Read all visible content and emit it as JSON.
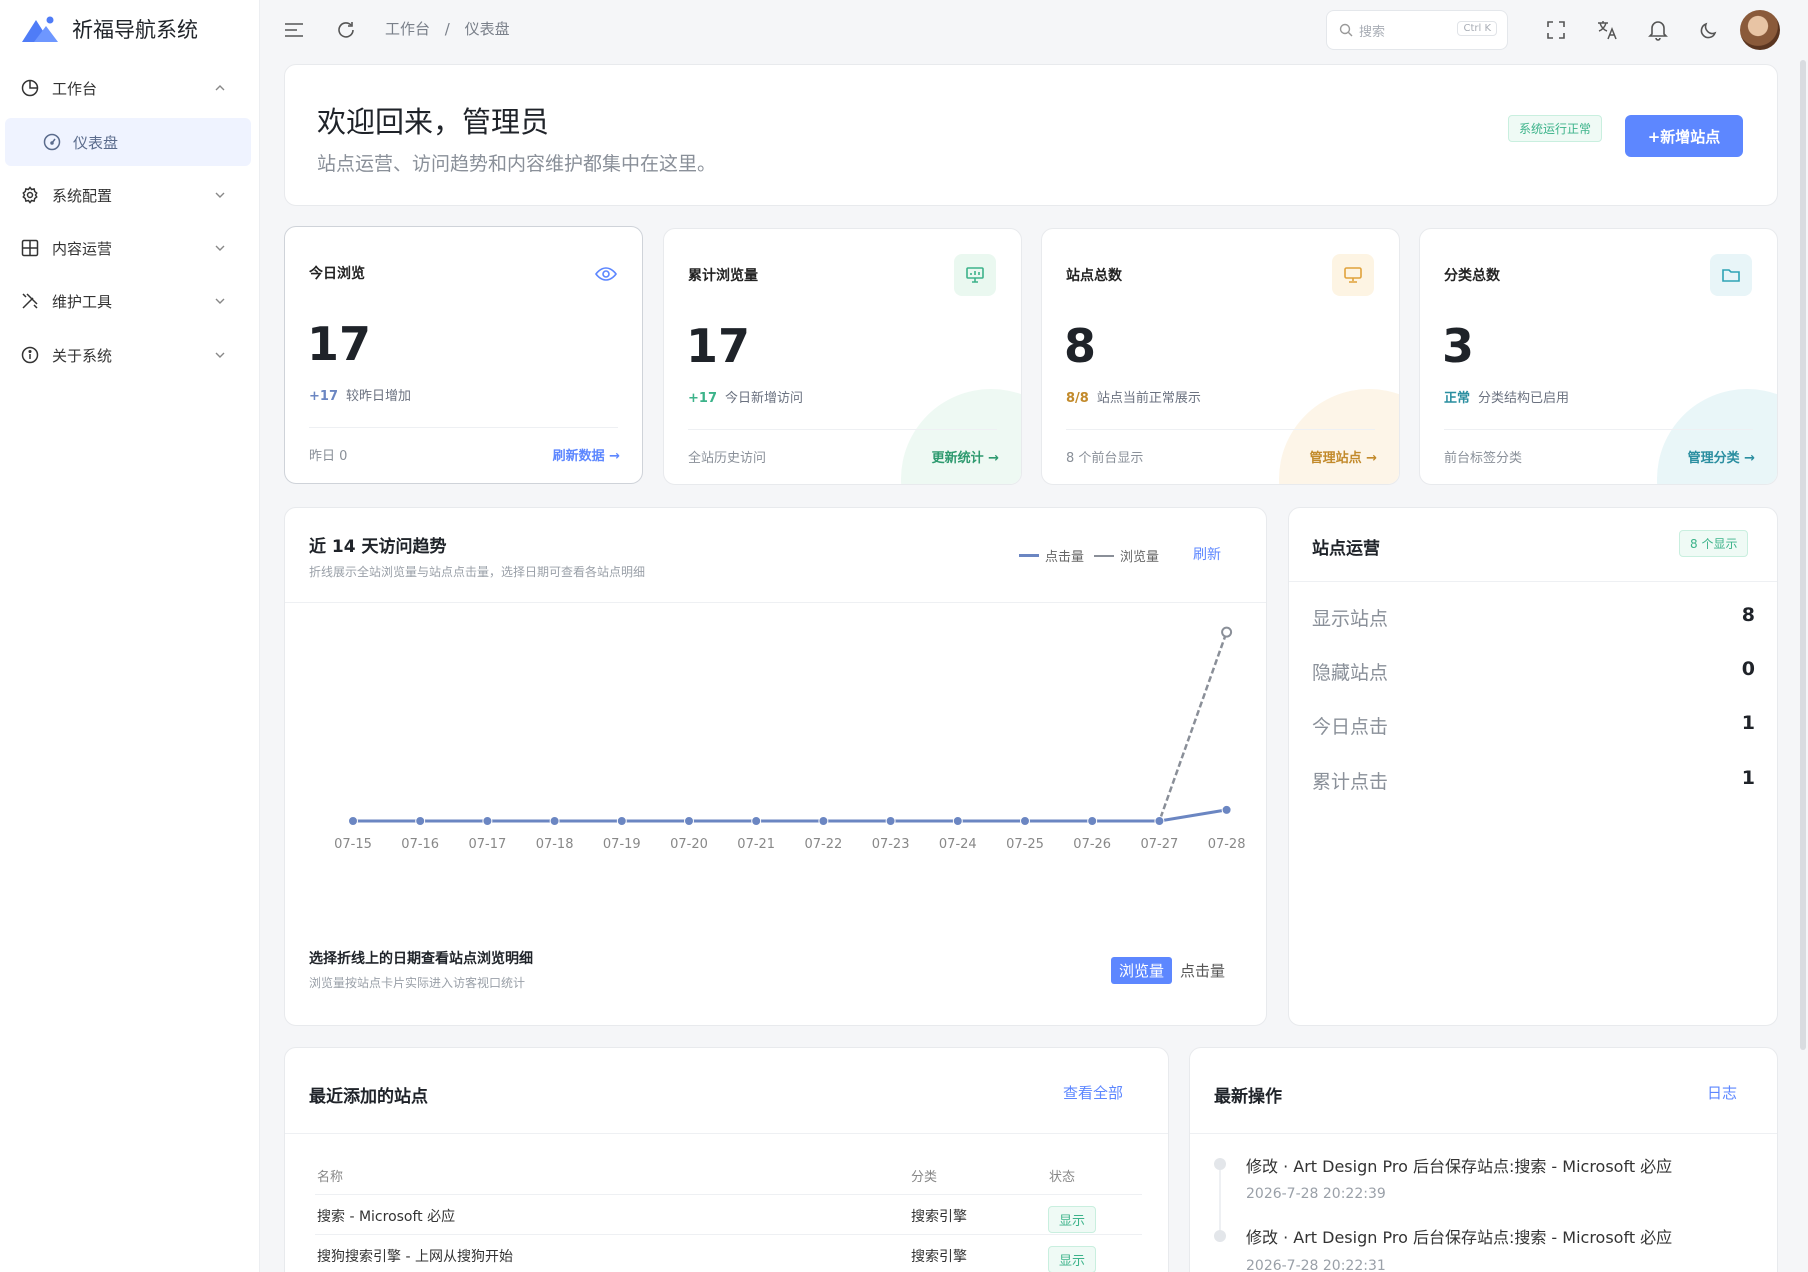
{
  "app": {
    "title": "祈福导航系统"
  },
  "sidebar": {
    "items": [
      {
        "label": "工作台",
        "icon": "pie-chart-icon"
      },
      {
        "label": "仪表盘",
        "icon": "dashboard-icon"
      },
      {
        "label": "系统配置",
        "icon": "gear-icon"
      },
      {
        "label": "内容运营",
        "icon": "grid-icon"
      },
      {
        "label": "维护工具",
        "icon": "tools-icon"
      },
      {
        "label": "关于系统",
        "icon": "info-icon"
      }
    ]
  },
  "header": {
    "breadcrumb": [
      "工作台",
      "仪表盘"
    ],
    "search_placeholder": "搜索",
    "search_shortcut": "Ctrl K"
  },
  "welcome": {
    "title": "欢迎回来，管理员",
    "subtitle": "站点运营、访问趋势和内容维护都集中在这里。",
    "status": "系统运行正常",
    "add_button": "+新增站点"
  },
  "stats": [
    {
      "label": "今日浏览",
      "value": "17",
      "delta": "+17",
      "delta_text": "较昨日增加",
      "foot": "昨日 0",
      "link": "刷新数据 →",
      "accent": "#5d87ff"
    },
    {
      "label": "累计浏览量",
      "value": "17",
      "delta": "+17",
      "delta_text": "今日新增访问",
      "foot": "全站历史访问",
      "link": "更新统计 →",
      "accent": "#3cb38a"
    },
    {
      "label": "站点总数",
      "value": "8",
      "delta": "8/8",
      "delta_text": "站点当前正常展示",
      "foot": "8 个前台显示",
      "link": "管理站点 →",
      "accent": "#e0a23b"
    },
    {
      "label": "分类总数",
      "value": "3",
      "delta": "正常",
      "delta_text": "分类结构已启用",
      "foot": "前台标签分类",
      "link": "管理分类 →",
      "accent": "#2fa3b5"
    }
  ],
  "trend": {
    "title": "近 14 天访问趋势",
    "subtitle": "折线展示全站浏览量与站点点击量，选择日期可查看各站点明细",
    "legend": [
      "点击量",
      "浏览量"
    ],
    "refresh": "刷新",
    "detail_title": "选择折线上的日期查看站点浏览明细",
    "detail_sub": "浏览量按站点卡片实际进入访客视口统计",
    "toggle": [
      "浏览量",
      "点击量"
    ]
  },
  "chart_data": {
    "type": "line",
    "categories": [
      "07-15",
      "07-16",
      "07-17",
      "07-18",
      "07-19",
      "07-20",
      "07-21",
      "07-22",
      "07-23",
      "07-24",
      "07-25",
      "07-26",
      "07-27",
      "07-28"
    ],
    "series": [
      {
        "name": "点击量",
        "values": [
          0,
          0,
          0,
          0,
          0,
          0,
          0,
          0,
          0,
          0,
          0,
          0,
          0,
          1
        ],
        "color": "#6b86c2"
      },
      {
        "name": "浏览量",
        "values": [
          0,
          0,
          0,
          0,
          0,
          0,
          0,
          0,
          0,
          0,
          0,
          0,
          0,
          17
        ],
        "color": "#8a8f98"
      }
    ],
    "ylim": [
      0,
      18
    ],
    "grid": false,
    "legend_position": "top-right"
  },
  "site_ops": {
    "title": "站点运营",
    "badge": "8 个显示",
    "rows": [
      {
        "label": "显示站点",
        "value": "8"
      },
      {
        "label": "隐藏站点",
        "value": "0"
      },
      {
        "label": "今日点击",
        "value": "1"
      },
      {
        "label": "累计点击",
        "value": "1"
      }
    ]
  },
  "recent": {
    "title": "最近添加的站点",
    "link": "查看全部",
    "columns": [
      "名称",
      "分类",
      "状态"
    ],
    "rows": [
      {
        "name": "搜索 - Microsoft 必应",
        "category": "搜索引擎",
        "status": "显示"
      },
      {
        "name": "搜狗搜索引擎 - 上网从搜狗开始",
        "category": "搜索引擎",
        "status": "显示"
      }
    ]
  },
  "ops_log": {
    "title": "最新操作",
    "link": "日志",
    "items": [
      {
        "text": "修改 · Art Design Pro 后台保存站点:搜索 - Microsoft 必应",
        "time": "2026-7-28 20:22:39"
      },
      {
        "text": "修改 · Art Design Pro 后台保存站点:搜索 - Microsoft 必应",
        "time": "2026-7-28 20:22:31"
      }
    ]
  }
}
